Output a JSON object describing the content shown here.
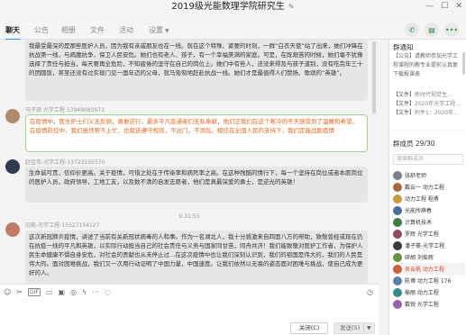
{
  "window": {
    "title": "2019级光能数理学院研究生",
    "edit_icon": "pencil-icon",
    "controls": [
      "minimize-icon",
      "maximize-icon",
      "close-icon"
    ]
  },
  "tabs": [
    {
      "label": "聊天",
      "active": true
    },
    {
      "label": "公告",
      "active": false
    },
    {
      "label": "相册",
      "active": false
    },
    {
      "label": "文件",
      "active": false
    },
    {
      "label": "活动",
      "active": false
    },
    {
      "label": "设置",
      "active": false
    }
  ],
  "header_actions": [
    "phone-icon",
    "chat-bubble-icon",
    "more-icon"
  ],
  "messages": [
    {
      "sender": "",
      "text": "我最受最深的是那些医护人员，因为我有亲戚朋友也在一线。就在这个特殊、紧要的时刻，一群“白衣天使”站了出来，她们冲锋在抗战第一线，与病魔抗争，保卫人民安危。她们也有老人、孩子，有一个幸福美满的家庭。可是，在既艰苦的时候，她们毫不犹豫选择了责任与担当，每天要再全危险，不知疲倦的坚守在自己的岗位上。她们中有些人，还没来得及与孩子道别，没有吃完年三十的团圆饭，甚至还没有过实现门见一面年迈的父母，就马匆匆地赶赴抗战一线。她们才是最值得人们赞扬、歌颂的“英雄”。",
      "highlight": false
    },
    {
      "sender": "马子琦 光学工程 13949083973",
      "text": "在疫情中，医生护士们义无反顾，勇敢逆行，最多平凡普通者们无私奉献，他们正我们在这个寒冷的冬天感受到了温暖和希望。在疫情防控中，我们虽然帮不上忙，也我该遵守规则，不出门，不添乱。相信在全国人民的支持下，我们定能战胜疫情",
      "highlight": true
    },
    {
      "sender": "赵佳伟-光学工程-13723195570",
      "text": "生命诚可贵，信仰价更高。关于疫情，可惜之处在于传染率和病死率之高。在这种残酷的情行下，每一个坚持在岗位或者本愿岗位的医护人员，政府领导，工地工友，以及数不清的自发志愿者，他们是真最深爱的勇士，是逆光的英雄！",
      "highlight": false
    },
    {
      "time": "9:31:55"
    },
    {
      "sender": "旧能-光学工程-15527154127",
      "text": "这次新冠肺炎疫情，讲述了当前有关新冠状病毒的人和事。作为一名湖北人，我十分感激来自四面八方的帮助，致敬曾经或现在仍在抗疫一线的平凡和英雄，以实际行动担当自己的社会责任与义务与国家同甘苦，同舟共济！我们能致敬对医护工作者，为保护人民生命健康不惧自身安危，对社会的贡献也从未停止过...在这次疫情中也让我们深刻认识到，我们的祖国是伟大的，我们的人民是伟大的。面对困难挑战，我们又一次用行动证明了中国力量，中国速度。让我们依然以无畏的姿态面对困难与挑战，使自己成为更好的人。",
      "highlight": false
    }
  ],
  "composer": {
    "tools": [
      "emoji-icon",
      "scissors-icon",
      "gif-icon",
      "folder-icon",
      "image-icon",
      "microphone-icon",
      "lightning-icon",
      "more-icon",
      "shake-icon"
    ],
    "gif_label": "GIF",
    "history_icon": "history-icon",
    "close_label": "关闭(C)",
    "send_label": "发送(S)"
  },
  "right_panel": {
    "notice_title": "群通知",
    "notice_text": "【公告】请教师参加光学工程课程的教专业提前认真复下载报课表",
    "files": [
      {
        "label": "【文件】",
        "name": "新时代视觉生..."
      },
      {
        "label": "【文件】",
        "name": "2020年光学工程..."
      },
      {
        "label": "【文件】",
        "name": "附件1：2020年..."
      }
    ],
    "members_label": "群成员 29/30",
    "member_search_placeholder": "搜索群成员",
    "members": [
      {
        "name": "张舒老师",
        "color": "#7a7f8a"
      },
      {
        "name": "戴云一 动力工程",
        "color": "#a5683f"
      },
      {
        "name": "动力工程 程勇",
        "color": "#c79b3f"
      },
      {
        "name": "光能所薛春",
        "color": "#4b6b9e"
      },
      {
        "name": "计算机技术",
        "color": "#3e7d4a"
      },
      {
        "name": "罗辉 光学工程",
        "color": "#8d4a5e"
      },
      {
        "name": "潘子豪-光学工程",
        "color": "#3b3b3b"
      },
      {
        "name": "研胡 刘俊辉",
        "color": "#6a8f3f"
      },
      {
        "name": "吴云帆 动力工程",
        "color": "#c8633a"
      },
      {
        "name": "陈博 动力工程 176",
        "color": "#5c7fa8"
      },
      {
        "name": "榆丽 动力工程",
        "color": "#3a8a8a"
      },
      {
        "name": "戴锐 光学工程",
        "color": "#9a5fb0"
      }
    ]
  }
}
